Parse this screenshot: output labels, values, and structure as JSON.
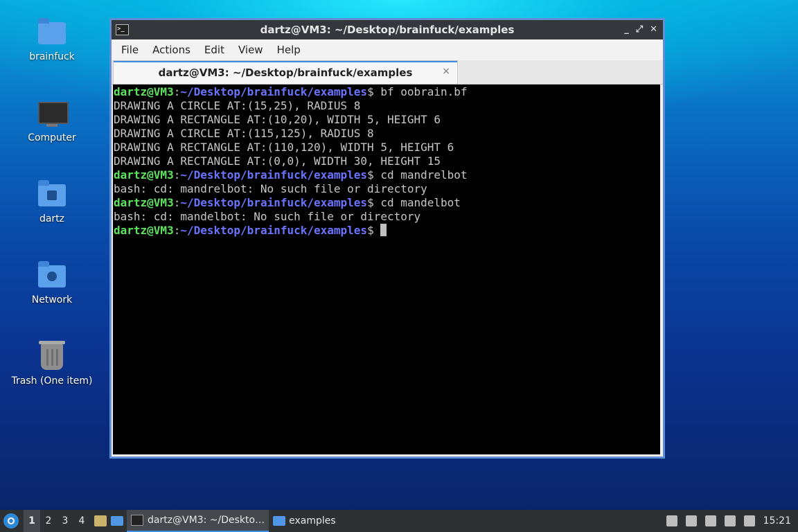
{
  "desktop": {
    "icons": [
      {
        "label": "brainfuck",
        "icon": "folder-icon"
      },
      {
        "label": "Computer",
        "icon": "monitor-icon"
      },
      {
        "label": "dartz",
        "icon": "home-folder-icon"
      },
      {
        "label": "Network",
        "icon": "network-folder-icon"
      },
      {
        "label": "Trash (One item)",
        "icon": "trash-icon"
      }
    ]
  },
  "window": {
    "title": "dartz@VM3: ~/Desktop/brainfuck/examples",
    "menu": [
      "File",
      "Actions",
      "Edit",
      "View",
      "Help"
    ],
    "tab_title": "dartz@VM3: ~/Desktop/brainfuck/examples",
    "tab_close": "×",
    "controls": [
      "_",
      "⤢",
      "✕"
    ]
  },
  "terminal": {
    "prompt_user": "dartz@VM3",
    "prompt_colon": ":",
    "prompt_path": "~/Desktop/brainfuck/examples",
    "prompt_symbol": "$ ",
    "lines": [
      {
        "type": "prompt",
        "cmd": "bf oobrain.bf"
      },
      {
        "type": "out",
        "text": "DRAWING A CIRCLE AT:(15,25), RADIUS 8"
      },
      {
        "type": "out",
        "text": "DRAWING A RECTANGLE AT:(10,20), WIDTH 5, HEIGHT 6"
      },
      {
        "type": "out",
        "text": "DRAWING A CIRCLE AT:(115,125), RADIUS 8"
      },
      {
        "type": "out",
        "text": "DRAWING A RECTANGLE AT:(110,120), WIDTH 5, HEIGHT 6"
      },
      {
        "type": "out",
        "text": "DRAWING A RECTANGLE AT:(0,0), WIDTH 30, HEIGHT 15"
      },
      {
        "type": "prompt",
        "cmd": "cd mandrelbot"
      },
      {
        "type": "out",
        "text": "bash: cd: mandrelbot: No such file or directory"
      },
      {
        "type": "prompt",
        "cmd": "cd mandelbot"
      },
      {
        "type": "out",
        "text": "bash: cd: mandelbot: No such file or directory"
      },
      {
        "type": "prompt",
        "cmd": ""
      }
    ]
  },
  "taskbar": {
    "workspaces": [
      "1",
      "2",
      "3",
      "4"
    ],
    "active_workspace": "1",
    "apps": [
      {
        "label": "dartz@VM3: ~/Deskto…",
        "active": true
      },
      {
        "label": "examples",
        "active": false
      }
    ],
    "clock": "15:21"
  },
  "colors": {
    "prompt_user": "#5fe35f",
    "prompt_path": "#6b74ff",
    "accent": "#3d8ee6"
  }
}
